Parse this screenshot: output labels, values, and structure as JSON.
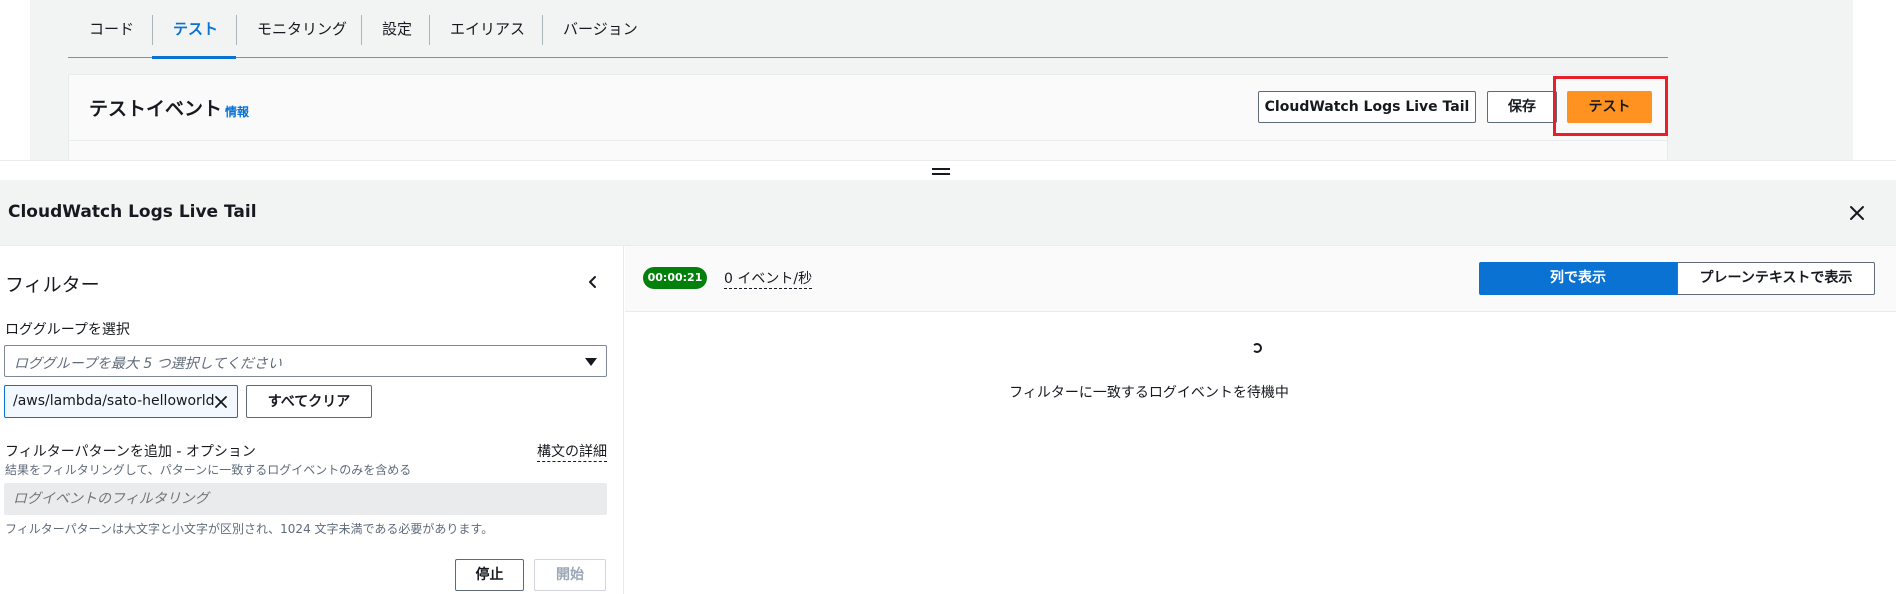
{
  "tabs": [
    {
      "label": "コード"
    },
    {
      "label": "テスト"
    },
    {
      "label": "モニタリング"
    },
    {
      "label": "設定"
    },
    {
      "label": "エイリアス"
    },
    {
      "label": "バージョン"
    }
  ],
  "test_card": {
    "title": "テストイベント",
    "info": "情報",
    "cw_button": "CloudWatch Logs Live Tail",
    "save_button": "保存",
    "test_button": "テスト"
  },
  "live_tail": {
    "title": "CloudWatch Logs Live Tail",
    "filter": {
      "title": "フィルター",
      "log_group_label": "ロググループを選択",
      "log_group_placeholder": "ロググループを最大 5 つ選択してください",
      "selected_group": "/aws/lambda/sato-helloworld",
      "clear_all": "すべてクリア",
      "pattern_label": "フィルターパターンを追加 - オプション",
      "syntax_link": "構文の詳細",
      "pattern_desc": "結果をフィルタリングして、パターンに一致するログイベントのみを含める",
      "pattern_placeholder": "ログイベントのフィルタリング",
      "pattern_hint": "フィルターパターンは大文字と小文字が区別され、1024 文字未満である必要があります。",
      "stop": "停止",
      "start": "開始"
    },
    "results": {
      "timer": "00:00:21",
      "rate": "0 イベント/秒",
      "view_columns": "列で表示",
      "view_plain": "プレーンテキストで表示",
      "waiting": "フィルターに一致するログイベントを待機中"
    }
  },
  "colors": {
    "accent": "#0972d3",
    "primary_button": "#ff9220",
    "highlight": "#e8202a",
    "timer_badge": "#037f0c"
  }
}
